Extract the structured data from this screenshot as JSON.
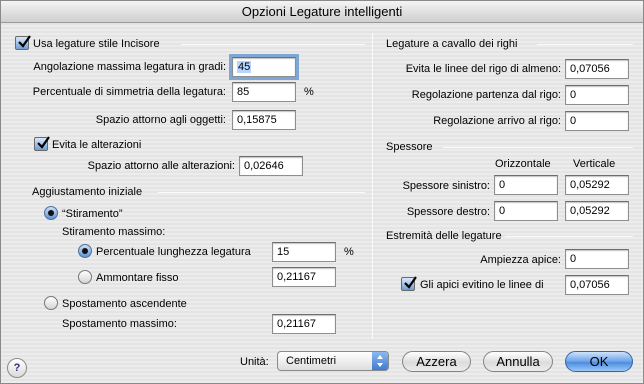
{
  "window": {
    "title": "Opzioni Legature intelligenti"
  },
  "left": {
    "engraver_checkbox": {
      "label": "Usa legature stile Incisore",
      "checked": true
    },
    "max_angle": {
      "label": "Angolazione massima legatura in gradi:",
      "value": "45"
    },
    "symmetry": {
      "label": "Percentuale di simmetria della legatura:",
      "value": "85",
      "unit": "%"
    },
    "object_space": {
      "label": "Spazio attorno agli oggetti:",
      "value": "0,15875"
    },
    "avoid_accidentals": {
      "label": "Evita le alterazioni",
      "checked": true
    },
    "accidental_space": {
      "label": "Spazio attorno alle alterazioni:",
      "value": "0,02646"
    },
    "initial_adjust": {
      "group_title": "Aggiustamento iniziale",
      "stretch_radio": {
        "label": "“Stiramento”",
        "selected": true
      },
      "max_stretch_label": "Stiramento massimo:",
      "percent_length": {
        "label": "Percentuale lunghezza legatura",
        "value": "15",
        "unit": "%",
        "selected": true
      },
      "fixed_amount": {
        "label": "Ammontare fisso",
        "value": "0,21167",
        "selected": false
      },
      "upward_shift": {
        "label": "Spostamento ascendente",
        "selected": false
      },
      "max_shift": {
        "label": "Spostamento massimo:",
        "value": "0,21167"
      }
    }
  },
  "right": {
    "cross_staff": {
      "group_title": "Legature a cavallo dei righi",
      "avoid_lines": {
        "label": "Evita le linee del rigo di almeno:",
        "value": "0,07056"
      },
      "start_adjust": {
        "label": "Regolazione partenza dal rigo:",
        "value": "0"
      },
      "end_adjust": {
        "label": "Regolazione arrivo al rigo:",
        "value": "0"
      }
    },
    "thickness": {
      "group_title": "Spessore",
      "col_horizontal": "Orizzontale",
      "col_vertical": "Verticale",
      "left": {
        "label": "Spessore sinistro:",
        "h": "0",
        "v": "0,05292"
      },
      "right": {
        "label": "Spessore destro:",
        "h": "0",
        "v": "0,05292"
      }
    },
    "ends": {
      "group_title": "Estremità delle legature",
      "tip_width": {
        "label": "Ampiezza apice:",
        "value": "0"
      },
      "avoid_lines": {
        "label": "Gli apici evitino le linee di",
        "value": "0,07056",
        "checked": true
      }
    }
  },
  "footer": {
    "help": "?",
    "units_label": "Unità:",
    "units_value": "Centimetri",
    "reset_button": "Azzera",
    "cancel_button": "Annulla",
    "ok_button": "OK"
  }
}
